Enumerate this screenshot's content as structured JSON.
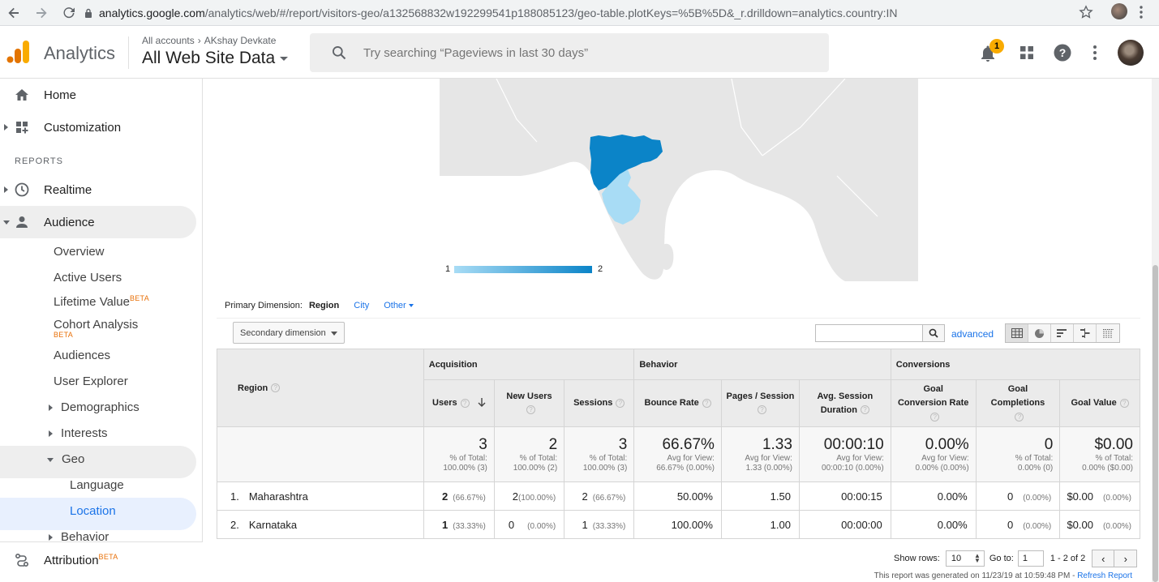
{
  "browser": {
    "url_host": "analytics.google.com",
    "url_path": "/analytics/web/#/report/visitors-geo/a132568832w192299541p188085123/geo-table.plotKeys=%5B%5D&_r.drilldown=analytics.country:IN"
  },
  "header": {
    "app_name": "Analytics",
    "crumb_all_accounts": "All accounts",
    "crumb_account": "AKshay Devkate",
    "property": "All Web Site Data",
    "search_placeholder": "Try searching “Pageviews in last 30 days”",
    "notification_count": "1"
  },
  "sidebar": {
    "home": "Home",
    "customization": "Customization",
    "reports_section": "REPORTS",
    "realtime": "Realtime",
    "audience": "Audience",
    "audience_items": [
      "Overview",
      "Active Users",
      "Lifetime Value",
      "Cohort Analysis",
      "Audiences",
      "User Explorer",
      "Demographics",
      "Interests",
      "Geo",
      "Behavior"
    ],
    "geo_items": [
      "Language",
      "Location"
    ],
    "beta_label": "BETA",
    "attribution": "Attribution"
  },
  "map": {
    "legend_min": "1",
    "legend_max": "2",
    "colors": {
      "high": "#0b84c8",
      "low": "#a8dcf5",
      "land": "#e6e6e6"
    }
  },
  "controls": {
    "primary_dimension_label": "Primary Dimension:",
    "dimensions": [
      "Region",
      "City",
      "Other"
    ],
    "secondary_dimension": "Secondary dimension",
    "advanced": "advanced"
  },
  "table": {
    "region_header": "Region",
    "groups": [
      "Acquisition",
      "Behavior",
      "Conversions"
    ],
    "columns": [
      "Users",
      "New Users",
      "Sessions",
      "Bounce Rate",
      "Pages / Session",
      "Avg. Session Duration",
      "Goal Conversion Rate",
      "Goal Completions",
      "Goal Value"
    ],
    "totals": [
      {
        "value": "3",
        "l1": "% of Total:",
        "l2": "100.00% (3)"
      },
      {
        "value": "2",
        "l1": "% of Total:",
        "l2": "100.00% (2)"
      },
      {
        "value": "3",
        "l1": "% of Total:",
        "l2": "100.00% (3)"
      },
      {
        "value": "66.67%",
        "l1": "Avg for View:",
        "l2": "66.67% (0.00%)"
      },
      {
        "value": "1.33",
        "l1": "Avg for View:",
        "l2": "1.33 (0.00%)"
      },
      {
        "value": "00:00:10",
        "l1": "Avg for View:",
        "l2": "00:00:10 (0.00%)"
      },
      {
        "value": "0.00%",
        "l1": "Avg for View:",
        "l2": "0.00% (0.00%)"
      },
      {
        "value": "0",
        "l1": "% of Total:",
        "l2": "0.00% (0)"
      },
      {
        "value": "$0.00",
        "l1": "% of Total:",
        "l2": "0.00% ($0.00)"
      }
    ],
    "rows": [
      {
        "idx": "1.",
        "region": "Maharashtra",
        "users": "2",
        "users_pct": "(66.67%)",
        "new_users": "2",
        "new_users_pct": "(100.00%)",
        "sessions": "2",
        "sessions_pct": "(66.67%)",
        "bounce": "50.00%",
        "pps": "1.50",
        "dur": "00:00:15",
        "gcr": "0.00%",
        "gc": "0",
        "gc_pct": "(0.00%)",
        "gv": "$0.00",
        "gv_pct": "(0.00%)"
      },
      {
        "idx": "2.",
        "region": "Karnataka",
        "users": "1",
        "users_pct": "(33.33%)",
        "new_users": "0",
        "new_users_pct": "(0.00%)",
        "sessions": "1",
        "sessions_pct": "(33.33%)",
        "bounce": "100.00%",
        "pps": "1.00",
        "dur": "00:00:00",
        "gcr": "0.00%",
        "gc": "0",
        "gc_pct": "(0.00%)",
        "gv": "$0.00",
        "gv_pct": "(0.00%)"
      }
    ]
  },
  "footer": {
    "show_rows_label": "Show rows:",
    "show_rows_value": "10",
    "goto_label": "Go to:",
    "goto_value": "1",
    "range": "1 - 2 of 2",
    "prev": "‹",
    "next": "›",
    "generated": "This report was generated on 11/23/19 at 10:59:48 PM - ",
    "refresh": "Refresh Report"
  }
}
